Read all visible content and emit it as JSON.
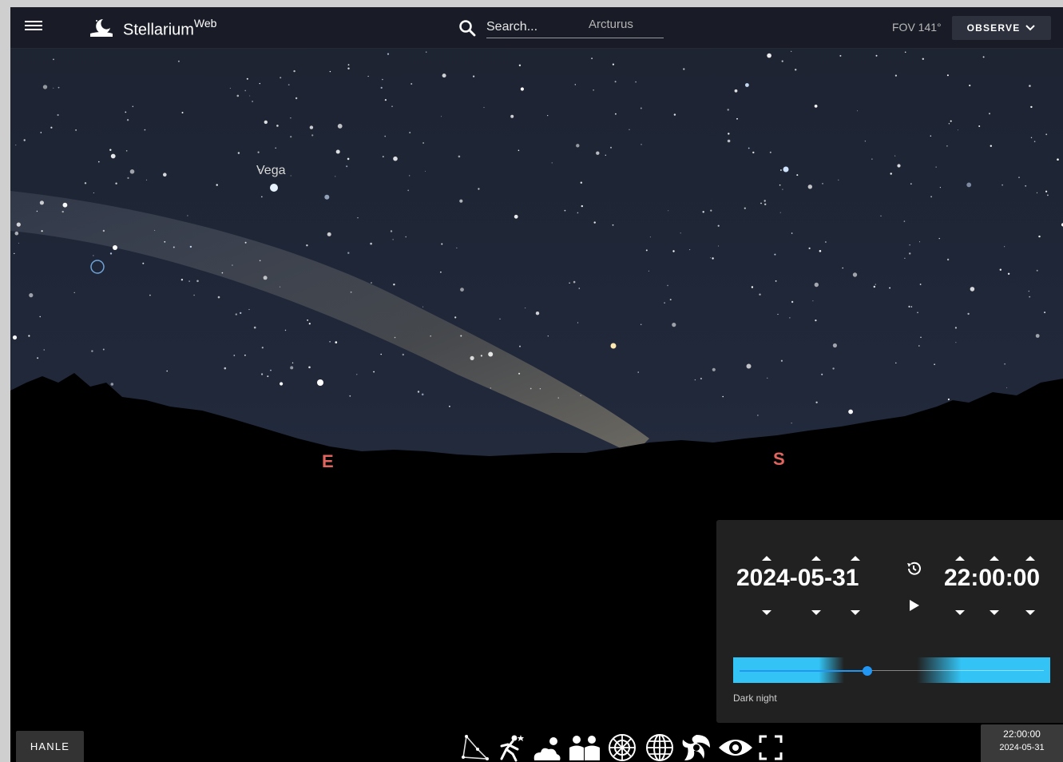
{
  "app": {
    "brand": "Stellarium",
    "brand_sup": "Web",
    "search_placeholder": "Search...",
    "fov_label": "FOV 141°",
    "observe_label": "OBSERVE"
  },
  "sky": {
    "labels": {
      "vega": "Vega",
      "arcturus": "Arcturus"
    },
    "cardinals": {
      "east": "E",
      "south": "S"
    }
  },
  "time_panel": {
    "date": "2024-05-31",
    "time": "22:00:00",
    "status": "Dark night",
    "slider_value": 0.42
  },
  "bottom_bar": {
    "location_label": "HANLE",
    "time_display": "22:00:00",
    "date_display": "2024-05-31",
    "tools": [
      "constellation-lines-icon",
      "constellation-art-icon",
      "atmosphere-icon",
      "landscape-icon",
      "azimuthal-grid-icon",
      "equatorial-grid-icon",
      "deep-sky-objects-icon",
      "night-mode-icon",
      "fullscreen-icon"
    ]
  },
  "colors": {
    "accent": "#2196f3",
    "slider_daylight": "#33c4f5",
    "cardinal": "#e0655f",
    "panel_bg": "#212121"
  }
}
